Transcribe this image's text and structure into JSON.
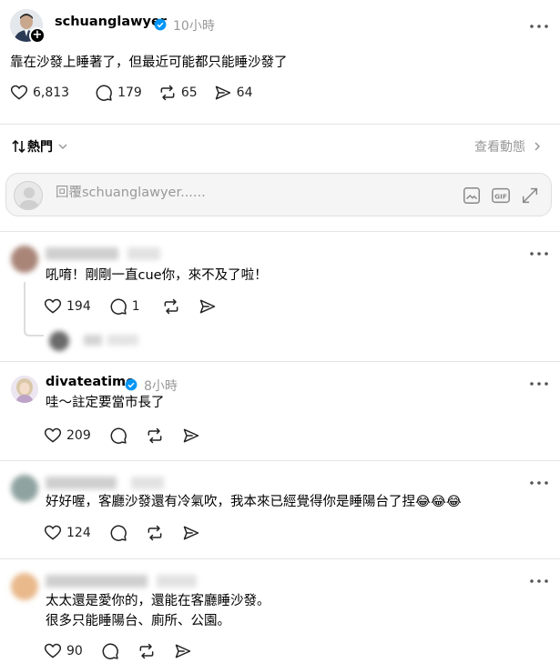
{
  "post": {
    "username": "schuanglawyer",
    "time": "10小時",
    "text": "靠在沙發上睡著了，但最近可能都只能睡沙發了",
    "likes": "6,813",
    "comments": "179",
    "reposts": "65",
    "shares": "64"
  },
  "sort": {
    "label": "熱門",
    "view_activity": "查看動態"
  },
  "reply_box": {
    "placeholder": "回覆schuanglawyer......"
  },
  "comments": [
    {
      "username": "",
      "time": "",
      "text": "吼唷！剛剛一直cue你，來不及了啦！",
      "likes": "194",
      "replies": "1"
    },
    {
      "username": "divateatime",
      "time": "8小時",
      "text": "哇～註定要當市長了",
      "likes": "209"
    },
    {
      "username": "",
      "time": "",
      "text": "好好喔，客廳沙發還有冷氣吹，我本來已經覺得你是睡陽台了捏😂😂😂",
      "likes": "124"
    },
    {
      "username": "",
      "time": "",
      "text": "太太還是愛你的，還能在客廳睡沙發。\n很多只能睡陽台、廁所、公園。",
      "likes": "90"
    }
  ]
}
